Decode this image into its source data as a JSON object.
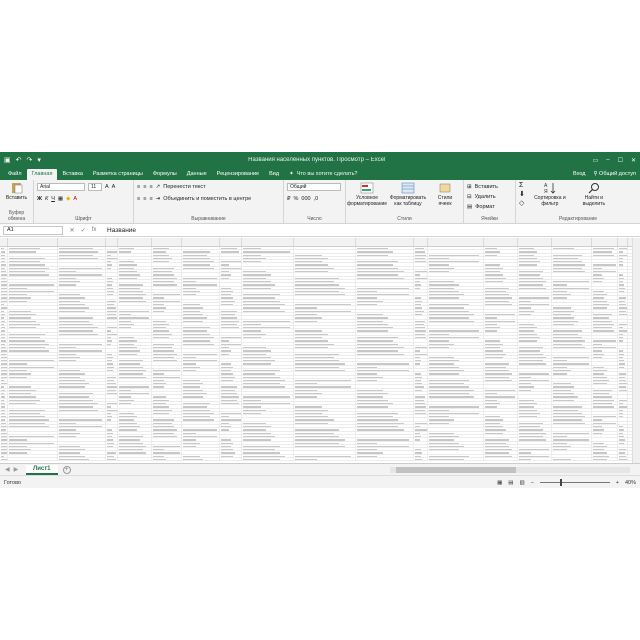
{
  "titlebar": {
    "title": "Названия населённых пунктов. Просмотр – Excel",
    "undo_icon": "undo-icon",
    "redo_icon": "redo-icon"
  },
  "tabs": [
    "Файл",
    "Главная",
    "Вставка",
    "Разметка страницы",
    "Формулы",
    "Данные",
    "Рецензирование",
    "Вид"
  ],
  "tell_me": "Что вы хотите сделать?",
  "signin": "Вход",
  "share": "Общий доступ",
  "ribbon": {
    "paste": "Вставить",
    "font_name": "Arial",
    "font_size": "11",
    "bold": "Ж",
    "italic": "К",
    "underline": "Ч",
    "wrap_text": "Перенести текст",
    "merge": "Объединить и поместить в центре",
    "number_format": "Общий",
    "conditional": "Условное форматирование",
    "format_table": "Форматировать как таблицу",
    "cell_styles": "Стили ячеек",
    "insert": "Вставить",
    "delete": "Удалить",
    "format": "Формат",
    "sort": "Сортировка и фильтр",
    "find": "Найти и выделить",
    "groups": {
      "clipboard": "Буфер обмена",
      "font": "Шрифт",
      "align": "Выравнивание",
      "number": "Число",
      "styles": "Стили",
      "cells": "Ячейки",
      "editing": "Редактирование"
    }
  },
  "formula_bar": {
    "name_box": "A1",
    "fx": "fx",
    "content": "Название"
  },
  "sheet": {
    "tab": "Лист1"
  },
  "status": {
    "ready": "Готово",
    "zoom": "40%"
  }
}
